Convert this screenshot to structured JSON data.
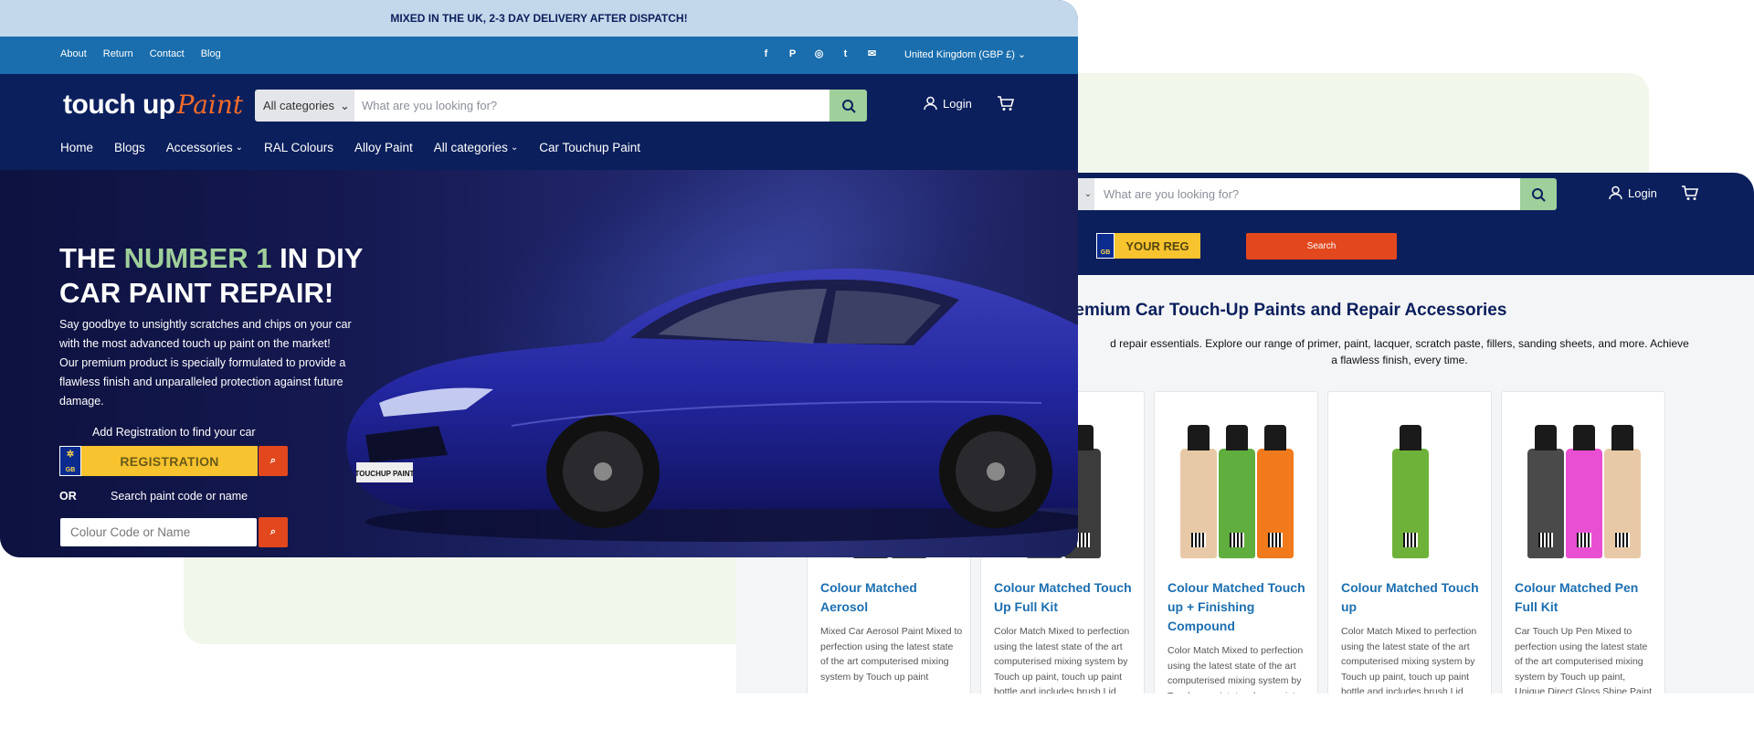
{
  "front": {
    "announcement": "MIXED IN THE UK, 2-3 DAY DELIVERY AFTER DISPATCH!",
    "top_links": [
      "About",
      "Return",
      "Contact",
      "Blog"
    ],
    "socials": [
      {
        "icon": "facebook-icon",
        "glyph": "f"
      },
      {
        "icon": "pinterest-icon",
        "glyph": "P"
      },
      {
        "icon": "instagram-icon",
        "glyph": "◎"
      },
      {
        "icon": "tumblr-icon",
        "glyph": "t"
      },
      {
        "icon": "email-icon",
        "glyph": "✉"
      }
    ],
    "country": "United Kingdom (GBP £)",
    "logo_part1": "touch up",
    "logo_part2": "Paint",
    "category_select": "All categories",
    "search_placeholder": "What are you looking for?",
    "login": "Login",
    "nav": [
      {
        "label": "Home",
        "dropdown": false
      },
      {
        "label": "Blogs",
        "dropdown": false
      },
      {
        "label": "Accessories",
        "dropdown": true
      },
      {
        "label": "RAL Colours",
        "dropdown": false
      },
      {
        "label": "Alloy Paint",
        "dropdown": false
      },
      {
        "label": "All categories",
        "dropdown": true
      },
      {
        "label": "Car Touchup Paint",
        "dropdown": false
      }
    ],
    "hero": {
      "title_pre": "THE ",
      "title_highlight": "NUMBER 1",
      "title_post": " IN DIY",
      "title_line2": "CAR PAINT REPAIR!",
      "paragraph": "Say goodbye to unsightly scratches and chips on your car with the most advanced touch up paint on the market! Our premium product is specially formulated to provide a flawless finish and unparalleled protection against future damage.",
      "reg_label": "Add Registration to find your car",
      "reg_flag_country": "GB",
      "reg_placeholder": "REGISTRATION",
      "or_label": "OR",
      "search_paint_label": "Search paint code or name",
      "code_placeholder": "Colour Code or Name",
      "plate_text": "TOUCHUP PAINT"
    },
    "colors": {
      "navy": "#0b1f5c",
      "topbar": "#1a6ead",
      "announce": "#c3d8ea",
      "accent_green": "#9fcf9a",
      "accent_orange": "#e2471d",
      "plate_yellow": "#f7c32e"
    }
  },
  "back": {
    "search_placeholder": "What are you looking for?",
    "login": "Login",
    "reg_flag_country": "GB",
    "reg_placeholder": "YOUR REG",
    "reg_button": "Search",
    "title": "remium Car Touch-Up Paints and Repair Accessories",
    "desc_line1": "d repair essentials. Explore our range of primer, paint, lacquer, scratch paste, fillers, sanding sheets, and more. Achieve",
    "desc_line2": "a flawless finish, every time.",
    "products": [
      {
        "title": "Colour Matched Aerosol",
        "desc": "Mixed Car Aerosol Paint Mixed to perfection using the latest state of the art computerised mixing system by Touch up paint",
        "bottles": [
          "#2b2b2b",
          "#3a3a3a"
        ]
      },
      {
        "title": "Colour Matched Touch Up Full Kit",
        "desc": "Color Match Mixed to perfection using the latest state of the art computerised mixing system by Touch up paint, touch up paint bottle and includes brush Lid",
        "bottles": [
          "#555555",
          "#3c3c3c"
        ]
      },
      {
        "title": "Colour Matched Touch up + Finishing Compound",
        "desc": "Color Match Mixed to perfection using the latest state of the art computerised mixing system by Touch up paint, touch up paint",
        "bottles": [
          "#e8c9a7",
          "#5fae3e",
          "#f07a1c"
        ]
      },
      {
        "title": "Colour Matched Touch up",
        "desc": "Color Match Mixed to perfection using the latest state of the art computerised mixing system by Touch up paint, touch up paint bottle and includes brush Lid",
        "bottles": [
          "#6fb23a"
        ]
      },
      {
        "title": "Colour Matched Pen Full Kit",
        "desc": "Car Touch Up Pen Mixed to perfection using the latest state of the art computerised mixing system by Touch up paint, Unique Direct Gloss Shine Paint",
        "bottles": [
          "#4a4a4a",
          "#e94fd2",
          "#e8c9a7"
        ]
      }
    ]
  }
}
